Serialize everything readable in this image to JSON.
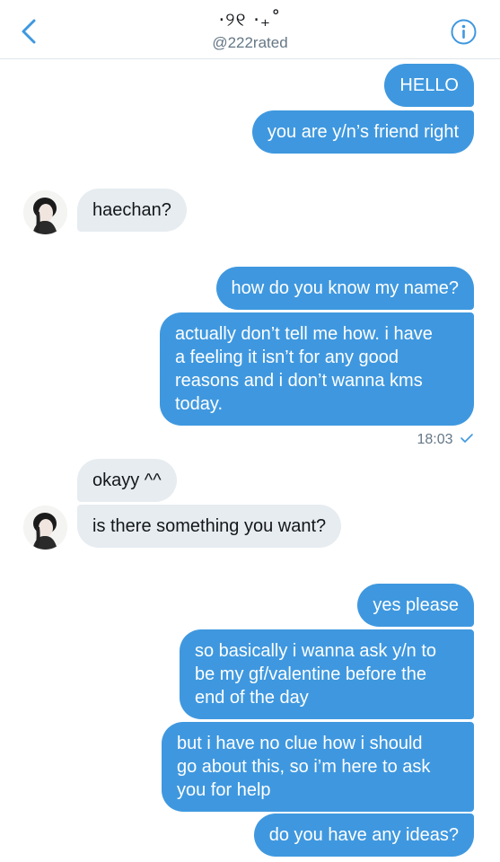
{
  "header": {
    "title": "·୨୧ ·₊˚",
    "handle": "@222rated"
  },
  "messages": [
    {
      "text": "HELLO"
    },
    {
      "text": "you are y/n’s friend right"
    },
    {
      "text": "haechan?"
    },
    {
      "text": "how do you know my name?"
    },
    {
      "text": "actually don’t tell me how. i have\na feeling it isn’t for any good\nreasons and i don’t wanna kms\ntoday."
    },
    {
      "text": "okayy ^^"
    },
    {
      "text": "is there something you want?"
    },
    {
      "text": "yes please"
    },
    {
      "text": "so basically i wanna ask y/n to\nbe my gf/valentine before the\nend of the day"
    },
    {
      "text": "but i have no clue how i should\ngo about this, so i’m here to ask\nyou for help"
    },
    {
      "text": "do you have any ideas?"
    }
  ],
  "timestamp": "18:03",
  "colors": {
    "accent": "#3f98df",
    "incoming": "#e6ecf0",
    "muted": "#657786"
  }
}
